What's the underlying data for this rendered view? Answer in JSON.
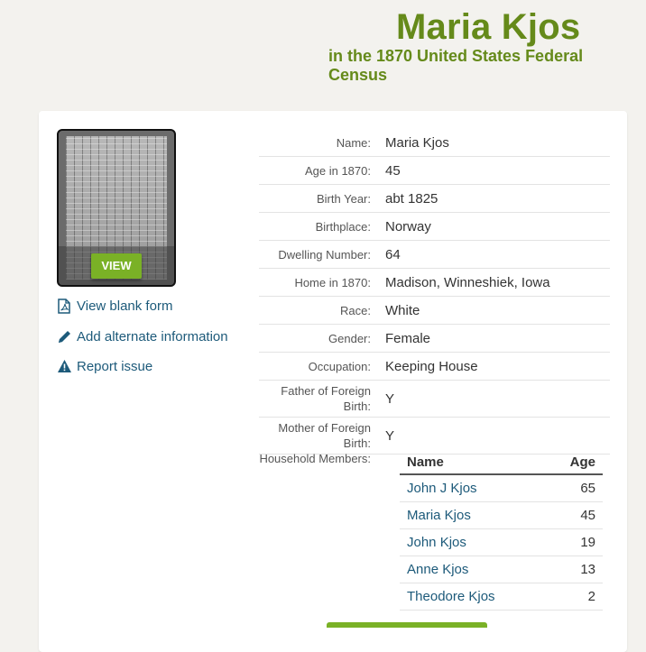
{
  "header": {
    "name": "Maria Kjos",
    "subtitle": "in the 1870 United States Federal Census"
  },
  "image": {
    "view_label": "VIEW"
  },
  "side_links": [
    {
      "label": "View blank form",
      "icon": "pdf-icon"
    },
    {
      "label": "Add alternate information",
      "icon": "pencil-icon"
    },
    {
      "label": "Report issue",
      "icon": "warning-icon"
    }
  ],
  "details": [
    {
      "label": "Name:",
      "value": "Maria Kjos"
    },
    {
      "label": "Age in 1870:",
      "value": "45"
    },
    {
      "label": "Birth Year:",
      "value": "abt 1825"
    },
    {
      "label": "Birthplace:",
      "value": "Norway"
    },
    {
      "label": "Dwelling Number:",
      "value": "64"
    },
    {
      "label": "Home in 1870:",
      "value": "Madison, Winneshiek, Iowa"
    },
    {
      "label": "Race:",
      "value": "White"
    },
    {
      "label": "Gender:",
      "value": "Female"
    },
    {
      "label": "Occupation:",
      "value": "Keeping House"
    },
    {
      "label": "Father of Foreign Birth:",
      "value": "Y"
    },
    {
      "label": "Mother of Foreign Birth:",
      "value": "Y"
    }
  ],
  "household": {
    "label": "Household Members:",
    "columns": {
      "name": "Name",
      "age": "Age"
    },
    "members": [
      {
        "name": "John J Kjos",
        "age": "65"
      },
      {
        "name": "Maria Kjos",
        "age": "45"
      },
      {
        "name": "John Kjos",
        "age": "19"
      },
      {
        "name": "Anne Kjos",
        "age": "13"
      },
      {
        "name": "Theodore Kjos",
        "age": "2"
      }
    ]
  },
  "colors": {
    "accent": "#658a1a",
    "button": "#7ab126",
    "link": "#1d5a7a"
  }
}
